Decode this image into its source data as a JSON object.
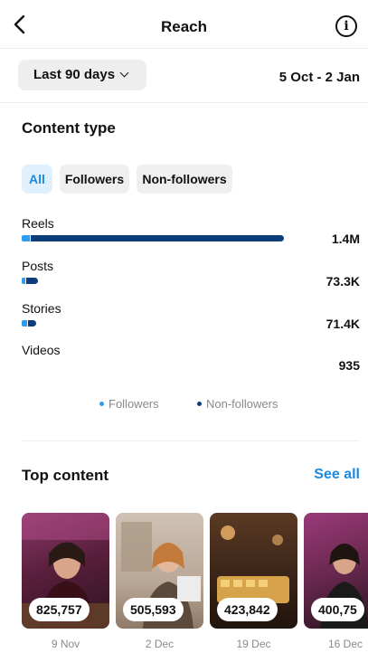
{
  "header": {
    "title": "Reach",
    "back_icon": "chevron-left-icon",
    "info_icon": "info-icon"
  },
  "range": {
    "selector_label": "Last 90 days",
    "dates": "5 Oct - 2 Jan"
  },
  "content_type": {
    "title": "Content type",
    "filters": [
      "All",
      "Followers",
      "Non-followers"
    ],
    "selected_filter": "All",
    "metrics": [
      {
        "label": "Reels",
        "value": "1.4M",
        "followers_fraction": 0.03,
        "non_followers_fraction": 0.97
      },
      {
        "label": "Posts",
        "value": "73.3K",
        "followers_fraction": 0.004,
        "non_followers_fraction": 0.045
      },
      {
        "label": "Stories",
        "value": "71.4K",
        "followers_fraction": 0.02,
        "non_followers_fraction": 0.03
      },
      {
        "label": "Videos",
        "value": "935",
        "followers_fraction": 0,
        "non_followers_fraction": 0
      }
    ],
    "legend": {
      "followers": "Followers",
      "non_followers": "Non-followers"
    }
  },
  "top_content": {
    "title": "Top content",
    "see_all": "See all",
    "items": [
      {
        "count": "825,757",
        "date": "9 Nov"
      },
      {
        "count": "505,593",
        "date": "2 Dec"
      },
      {
        "count": "423,842",
        "date": "19 Dec"
      },
      {
        "count": "400,75",
        "date": "16 Dec"
      }
    ]
  },
  "colors": {
    "accent": "#1a8be0",
    "followers": "#2f9cf0",
    "non_followers": "#0a3d7a",
    "chip_bg": "#efefef",
    "chip_active_bg": "#e0f0fc"
  }
}
